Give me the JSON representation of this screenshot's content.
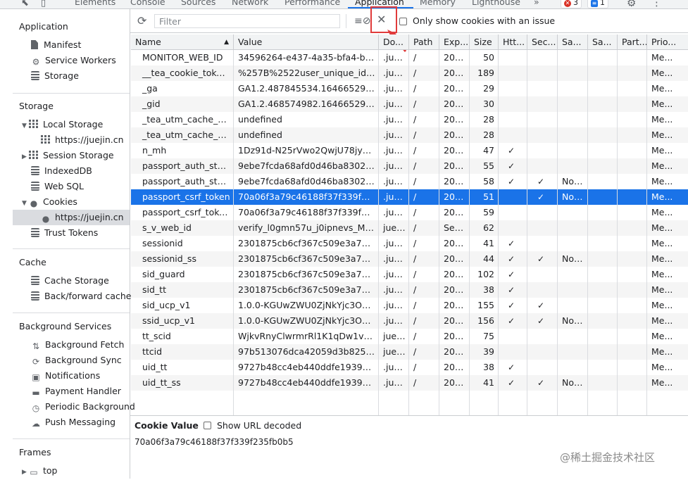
{
  "devtools": {
    "tabs": [
      {
        "label": "Elements",
        "active": false
      },
      {
        "label": "Console",
        "active": false
      },
      {
        "label": "Sources",
        "active": false
      },
      {
        "label": "Network",
        "active": false
      },
      {
        "label": "Performance",
        "active": false
      },
      {
        "label": "Application",
        "active": true
      },
      {
        "label": "Memory",
        "active": false
      },
      {
        "label": "Lighthouse",
        "active": false
      }
    ],
    "more_tabs": "»",
    "errors_count": "3",
    "messages_count": "1"
  },
  "sidebar": {
    "application": {
      "title": "Application",
      "items": [
        "Manifest",
        "Service Workers",
        "Storage"
      ]
    },
    "storage": {
      "title": "Storage",
      "local_storage": "Local Storage",
      "local_storage_origin": "https://juejin.cn",
      "session_storage": "Session Storage",
      "indexeddb": "IndexedDB",
      "websql": "Web SQL",
      "cookies": "Cookies",
      "cookies_origin": "https://juejin.cn",
      "trust_tokens": "Trust Tokens"
    },
    "cache": {
      "title": "Cache",
      "items": [
        "Cache Storage",
        "Back/forward cache"
      ]
    },
    "background_services": {
      "title": "Background Services",
      "items": [
        "Background Fetch",
        "Background Sync",
        "Notifications",
        "Payment Handler",
        "Periodic Background",
        "Push Messaging"
      ]
    },
    "frames": {
      "title": "Frames",
      "items": [
        "top"
      ]
    }
  },
  "toolbar": {
    "filter_placeholder": "Filter",
    "only_issue_label": "Only show cookies with an issue"
  },
  "table": {
    "columns": [
      "Name",
      "Value",
      "Do...",
      "Path",
      "Exp...",
      "Size",
      "Htt...",
      "Sec...",
      "Sa...",
      "Sa...",
      "Part...",
      "Prio..."
    ],
    "rows": [
      {
        "name": "MONITOR_WEB_ID",
        "value": "34596264-e437-4a35-bfa4-b16...",
        "domain": ".jue...",
        "path": "/",
        "expires": "202...",
        "size": "50",
        "http": "",
        "secure": "",
        "samesite": "",
        "sameparty": "",
        "partition": "",
        "priority": "Me..."
      },
      {
        "name": "__tea_cookie_token...",
        "value": "%257B%2522user_unique_id%2...",
        "domain": ".jue...",
        "path": "/",
        "expires": "202...",
        "size": "189",
        "http": "",
        "secure": "",
        "samesite": "",
        "sameparty": "",
        "partition": "",
        "priority": "Me..."
      },
      {
        "name": "_ga",
        "value": "GA1.2.487845534.1646652925",
        "domain": ".jue...",
        "path": "/",
        "expires": "202...",
        "size": "29",
        "http": "",
        "secure": "",
        "samesite": "",
        "sameparty": "",
        "partition": "",
        "priority": "Me..."
      },
      {
        "name": "_gid",
        "value": "GA1.2.468574982.1646652925",
        "domain": ".jue...",
        "path": "/",
        "expires": "202...",
        "size": "30",
        "http": "",
        "secure": "",
        "samesite": "",
        "sameparty": "",
        "partition": "",
        "priority": "Me..."
      },
      {
        "name": "_tea_utm_cache_2018",
        "value": "undefined",
        "domain": ".jue...",
        "path": "/",
        "expires": "202...",
        "size": "28",
        "http": "",
        "secure": "",
        "samesite": "",
        "sameparty": "",
        "partition": "",
        "priority": "Me..."
      },
      {
        "name": "_tea_utm_cache_2608",
        "value": "undefined",
        "domain": ".jue...",
        "path": "/",
        "expires": "202...",
        "size": "28",
        "http": "",
        "secure": "",
        "samesite": "",
        "sameparty": "",
        "partition": "",
        "priority": "Me..."
      },
      {
        "name": "n_mh",
        "value": "1Dz91d-N25rVwo2QwjU78jyXJj...",
        "domain": ".jue...",
        "path": "/",
        "expires": "202...",
        "size": "47",
        "http": "✓",
        "secure": "",
        "samesite": "",
        "sameparty": "",
        "partition": "",
        "priority": "Me..."
      },
      {
        "name": "passport_auth_status",
        "value": "9ebe7fcda68afd0d46ba83020b...",
        "domain": ".jue...",
        "path": "/",
        "expires": "202...",
        "size": "55",
        "http": "✓",
        "secure": "",
        "samesite": "",
        "sameparty": "",
        "partition": "",
        "priority": "Me..."
      },
      {
        "name": "passport_auth_stat...",
        "value": "9ebe7fcda68afd0d46ba83020b...",
        "domain": ".jue...",
        "path": "/",
        "expires": "202...",
        "size": "58",
        "http": "✓",
        "secure": "✓",
        "samesite": "None",
        "sameparty": "",
        "partition": "",
        "priority": "Me..."
      },
      {
        "name": "passport_csrf_token",
        "value": "70a06f3a79c46188f37f339f235f...",
        "domain": ".jue...",
        "path": "/",
        "expires": "202...",
        "size": "51",
        "http": "",
        "secure": "✓",
        "samesite": "None",
        "sameparty": "",
        "partition": "",
        "priority": "Me...",
        "selected": true
      },
      {
        "name": "passport_csrf_token...",
        "value": "70a06f3a79c46188f37f339f235f...",
        "domain": ".jue...",
        "path": "/",
        "expires": "202...",
        "size": "59",
        "http": "",
        "secure": "",
        "samesite": "",
        "sameparty": "",
        "partition": "",
        "priority": "Me..."
      },
      {
        "name": "s_v_web_id",
        "value": "verify_l0gmn57u_j0ipnevs_MXp...",
        "domain": "juej...",
        "path": "/",
        "expires": "Ses...",
        "size": "62",
        "http": "",
        "secure": "",
        "samesite": "",
        "sameparty": "",
        "partition": "",
        "priority": "Me..."
      },
      {
        "name": "sessionid",
        "value": "2301875cb6cf367c509e3a77500...",
        "domain": ".jue...",
        "path": "/",
        "expires": "202...",
        "size": "41",
        "http": "✓",
        "secure": "",
        "samesite": "",
        "sameparty": "",
        "partition": "",
        "priority": "Me..."
      },
      {
        "name": "sessionid_ss",
        "value": "2301875cb6cf367c509e3a77500...",
        "domain": ".jue...",
        "path": "/",
        "expires": "202...",
        "size": "44",
        "http": "✓",
        "secure": "✓",
        "samesite": "None",
        "sameparty": "",
        "partition": "",
        "priority": "Me..."
      },
      {
        "name": "sid_guard",
        "value": "2301875cb6cf367c509e3a77500...",
        "domain": ".jue...",
        "path": "/",
        "expires": "202...",
        "size": "102",
        "http": "✓",
        "secure": "",
        "samesite": "",
        "sameparty": "",
        "partition": "",
        "priority": "Me..."
      },
      {
        "name": "sid_tt",
        "value": "2301875cb6cf367c509e3a77500...",
        "domain": ".jue...",
        "path": "/",
        "expires": "202...",
        "size": "38",
        "http": "✓",
        "secure": "",
        "samesite": "",
        "sameparty": "",
        "partition": "",
        "priority": "Me..."
      },
      {
        "name": "sid_ucp_v1",
        "value": "1.0.0-KGUwZWU0ZjNkYjc3ODM...",
        "domain": ".jue...",
        "path": "/",
        "expires": "202...",
        "size": "155",
        "http": "✓",
        "secure": "✓",
        "samesite": "",
        "sameparty": "",
        "partition": "",
        "priority": "Me..."
      },
      {
        "name": "ssid_ucp_v1",
        "value": "1.0.0-KGUwZWU0ZjNkYjc3ODM...",
        "domain": ".jue...",
        "path": "/",
        "expires": "202...",
        "size": "156",
        "http": "✓",
        "secure": "✓",
        "samesite": "None",
        "sameparty": "",
        "partition": "",
        "priority": "Me..."
      },
      {
        "name": "tt_scid",
        "value": "WjkvRnyClwrmrRl1K1qDw1vPV...",
        "domain": "juej...",
        "path": "/",
        "expires": "202...",
        "size": "75",
        "http": "",
        "secure": "",
        "samesite": "",
        "sameparty": "",
        "partition": "",
        "priority": "Me..."
      },
      {
        "name": "ttcid",
        "value": "97b513076dca42059d3b8254fd...",
        "domain": "juej...",
        "path": "/",
        "expires": "202...",
        "size": "39",
        "http": "",
        "secure": "",
        "samesite": "",
        "sameparty": "",
        "partition": "",
        "priority": "Me..."
      },
      {
        "name": "uid_tt",
        "value": "9727b48cc4eb440ddfe19391bc...",
        "domain": ".jue...",
        "path": "/",
        "expires": "202...",
        "size": "38",
        "http": "✓",
        "secure": "",
        "samesite": "",
        "sameparty": "",
        "partition": "",
        "priority": "Me..."
      },
      {
        "name": "uid_tt_ss",
        "value": "9727b48cc4eb440ddfe19391bc...",
        "domain": ".jue...",
        "path": "/",
        "expires": "202...",
        "size": "41",
        "http": "✓",
        "secure": "✓",
        "samesite": "None",
        "sameparty": "",
        "partition": "",
        "priority": "Me..."
      }
    ]
  },
  "detail": {
    "cookie_value_label": "Cookie Value",
    "show_url_decoded_label": "Show URL decoded",
    "value": "70a06f3a79c46188f37f339f235fb0b5"
  },
  "watermark": "@稀土掘金技术社区",
  "colors": {
    "selection": "#1a73e8",
    "highlight_box": "#e03b3b",
    "error_badge": "#d93025",
    "message_badge": "#1a73e8"
  }
}
